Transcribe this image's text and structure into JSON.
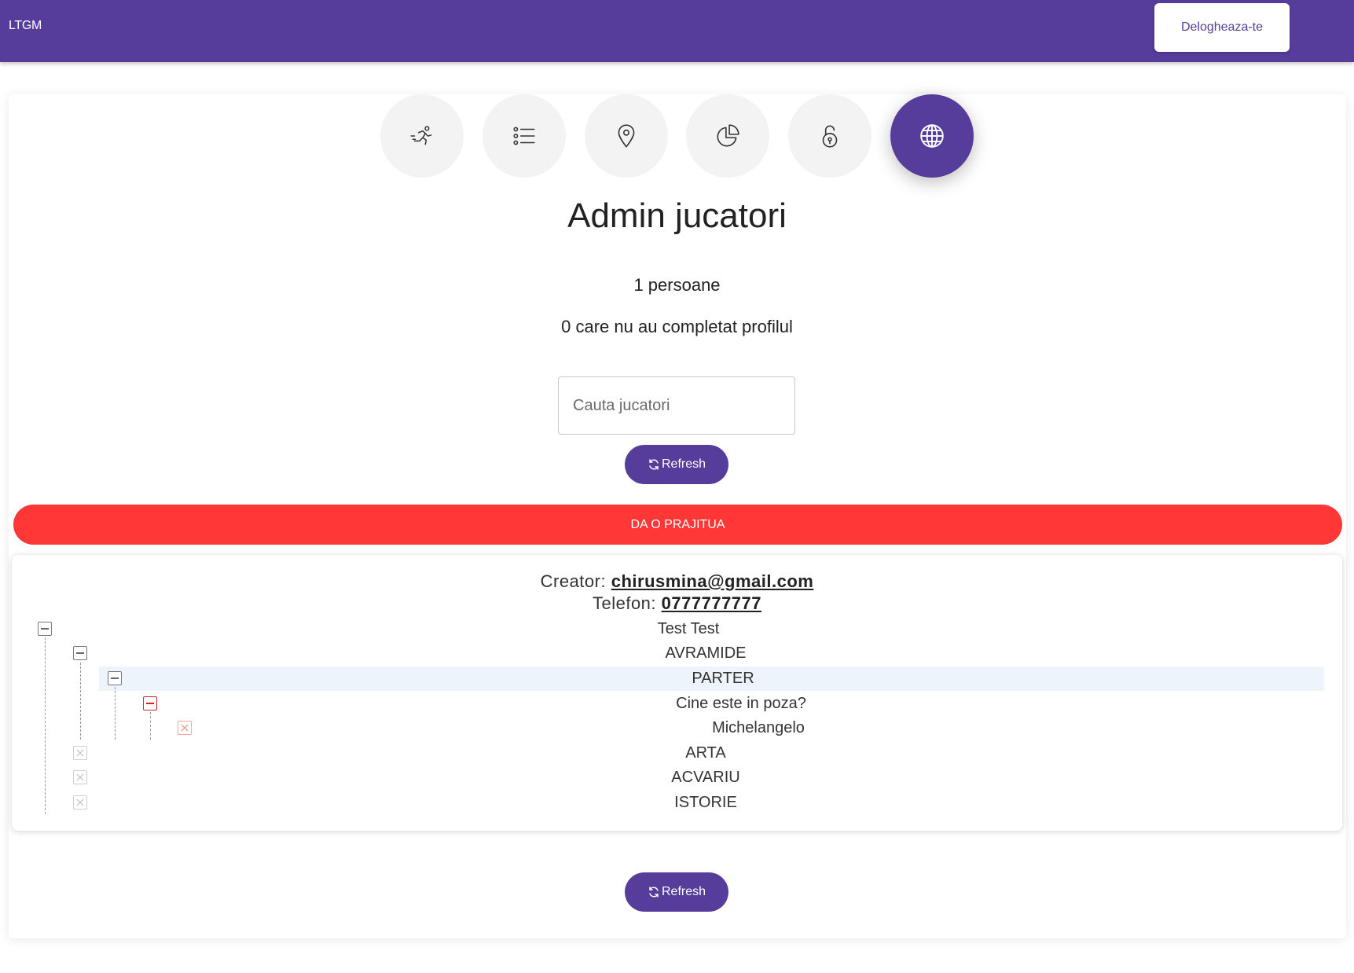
{
  "header": {
    "brand": "LTGM",
    "logout_label": "Delogheaza-te"
  },
  "nav": {
    "items": [
      {
        "icon": "running-person-icon"
      },
      {
        "icon": "list-icon"
      },
      {
        "icon": "location-pin-icon"
      },
      {
        "icon": "pie-chart-icon"
      },
      {
        "icon": "unlock-icon"
      },
      {
        "icon": "globe-icon",
        "active": true
      }
    ]
  },
  "page": {
    "title": "Admin jucatori",
    "persons_count": "1 persoane",
    "incomplete_profiles": "0 care nu au completat profilul",
    "search_placeholder": "Cauta jucatori",
    "refresh_label": "Refresh",
    "cake_label": "DA O PRAJITUA"
  },
  "player": {
    "creator_label": "Creator:",
    "creator_email": "chirusmina@gmail.com",
    "phone_label": "Telefon:",
    "phone": "0777777777"
  },
  "tree": {
    "root": "Test Test",
    "group": "AVRAMIDE",
    "subgroup": "PARTER",
    "question": "Cine este in poza?",
    "answer": "Michelangelo",
    "siblings": [
      "ARTA",
      "ACVARIU",
      "ISTORIE"
    ]
  },
  "colors": {
    "primary": "#563d9c",
    "danger": "#ff3737",
    "highlight": "#edf4fc"
  }
}
